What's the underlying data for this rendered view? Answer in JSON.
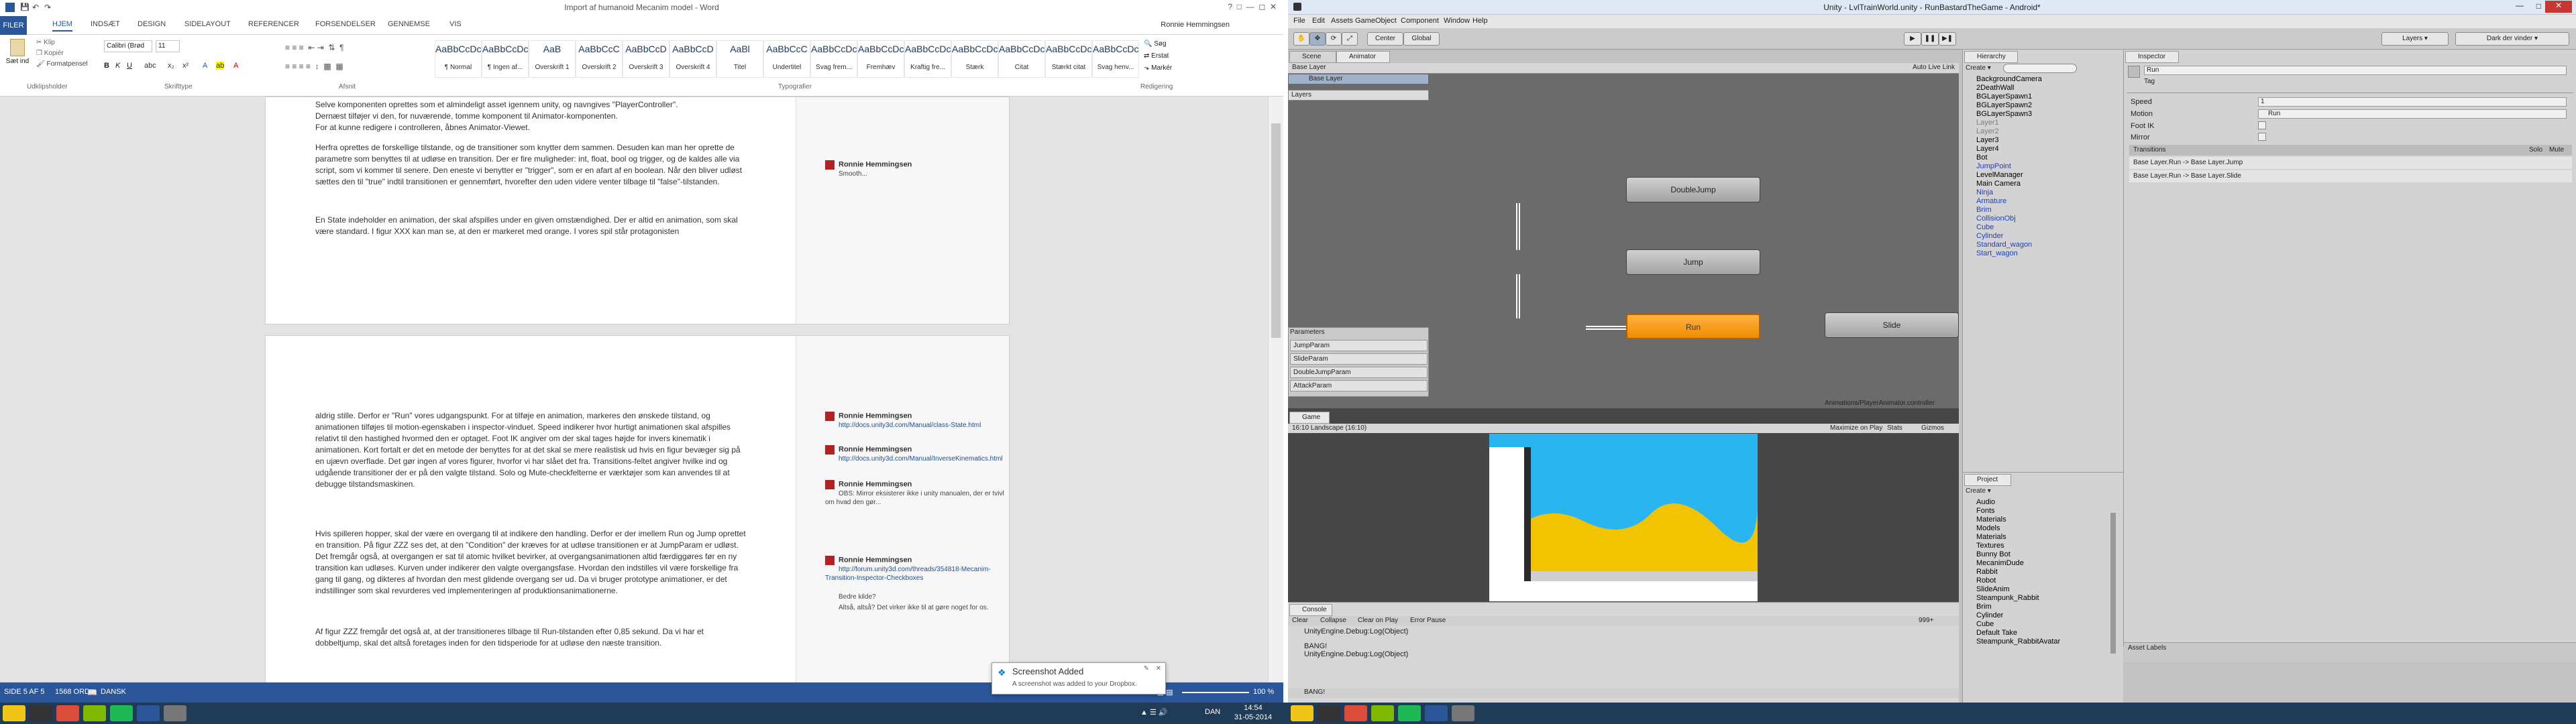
{
  "word": {
    "title": "Import af humanoid Mecanim model - Word",
    "user": "Ronnie Hemmingsen",
    "file_tab": "FILER",
    "tabs": [
      "HJEM",
      "INDSÆT",
      "DESIGN",
      "SIDELAYOUT",
      "REFERENCER",
      "FORSENDELSER",
      "GENNEMSE",
      "VIS"
    ],
    "clipboard": {
      "paste": "Sæt ind",
      "cut": "Klip",
      "copy": "Kopiér",
      "format_painter": "Formatpensel",
      "group": "Udklipsholder"
    },
    "font": {
      "name": "Calibri (Brød",
      "size": "11",
      "group": "Skrifttype"
    },
    "paragraph_group": "Afsnit",
    "styles": [
      {
        "preview": "AaBbCcDc",
        "name": "¶ Normal"
      },
      {
        "preview": "AaBbCcDc",
        "name": "¶ Ingen af..."
      },
      {
        "preview": "AaB",
        "name": "Overskrift 1"
      },
      {
        "preview": "AaBbCcC",
        "name": "Overskrift 2"
      },
      {
        "preview": "AaBbCcD",
        "name": "Overskrift 3"
      },
      {
        "preview": "AaBbCcD",
        "name": "Overskrift 4"
      },
      {
        "preview": "AaBl",
        "name": "Titel"
      },
      {
        "preview": "AaBbCcC",
        "name": "Undertitel"
      },
      {
        "preview": "AaBbCcDc",
        "name": "Svag frem..."
      },
      {
        "preview": "AaBbCcDc",
        "name": "Fremhæv"
      },
      {
        "preview": "AaBbCcDc",
        "name": "Kraftig fre..."
      },
      {
        "preview": "AaBbCcDc",
        "name": "Stærk"
      },
      {
        "preview": "AaBbCcDc",
        "name": "Citat"
      },
      {
        "preview": "AaBbCcDc",
        "name": "Stærkt citat"
      },
      {
        "preview": "AaBbCcDc",
        "name": "Svag henv..."
      }
    ],
    "styles_group": "Typografier",
    "editing": {
      "find": "Søg",
      "replace": "Erstat",
      "select": "Markér",
      "group": "Redigering"
    },
    "page1_paragraphs": [
      "Selve komponenten oprettes som et almindeligt asset igennem unity, og navngives \"PlayerController\".",
      "Dernæst tilføjer vi den, for nuværende, tomme komponent til Animator-komponenten.",
      "For at kunne redigere i controlleren, åbnes Animator-Viewet.",
      "Herfra oprettes de forskellige tilstande, og de transitioner som knytter dem sammen. Desuden kan man her oprette de parametre som benyttes til at udløse en transition. Der er fire muligheder: int, float, bool og trigger, og de kaldes alle via script, som vi kommer til senere. Den eneste vi benytter er \"trigger\", som er en afart af en boolean. Når den bliver udløst sættes den til \"true\" indtil transitionen er gennemført, hvorefter den uden videre venter tilbage til \"false\"-tilstanden.",
      "En State indeholder en animation, der skal afspilles under en given omstændighed. Der er altid en animation, som skal være standard. I figur XXX kan man se, at den er markeret med orange. I vores spil står protagonisten"
    ],
    "page1_comment": {
      "author": "Ronnie Hemmingsen",
      "text": "Smooth..."
    },
    "page2_paragraphs": [
      "aldrig stille. Derfor er \"Run\" vores udgangspunkt. For at tilføje en animation, markeres den ønskede tilstand, og animationen tilføjes til motion-egenskaben i inspector-vinduet. Speed indikerer hvor hurtigt animationen skal afspilles relativt til den hastighed hvormed den er optaget. Foot IK angiver om der skal tages højde for invers kinematik i animationen. Kort fortalt er det en metode der benyttes for at det skal se mere realistisk ud hvis en figur bevæger sig på en ujævn overflade. Det gør ingen af vores figurer, hvorfor vi har slået det fra. Transitions-feltet angiver hvilke ind og udgående transitioner der er på den valgte tilstand. Solo og Mute-checkfelterne er værktøjer som kan anvendes til at debugge tilstandsmaskinen.",
      "Hvis spilleren hopper, skal der være en overgang til at indikere den handling. Derfor er der imellem Run og Jump oprettet en transition. På figur ZZZ ses det, at den \"Condition\" der kræves for at udløse transitionen er at JumpParam er udløst. Det fremgår også, at overgangen er sat til atomic hvilket bevirker, at overgangsanimationen altid færdiggøres før en ny transition kan udløses. Kurven under indikerer den valgte overgangsfase. Hvordan den indstilles vil være forskellige fra gang til gang, og dikteres af hvordan den mest glidende overgang ser ud. Da vi bruger prototype animationer, er det indstillinger som skal revurderes ved implementeringen af produktionsanimationerne.",
      "Af figur ZZZ fremgår det også at, at der transitioneres tilbage til Run-tilstanden efter 0,85 sekund. Da vi har et dobbeltjump, skal det altså foretages inden for den tidsperiode for at udløse den næste transition."
    ],
    "page2_comments": [
      {
        "author": "Ronnie Hemmingsen",
        "text": "http://docs.unity3d.com/Manual/class-State.html"
      },
      {
        "author": "Ronnie Hemmingsen",
        "text": "http://docs.unity3d.com/Manual/InverseKinematics.html"
      },
      {
        "author": "Ronnie Hemmingsen",
        "text": "OBS: Mirror eksisterer ikke i unity manualen, der er tvivl om hvad den gør..."
      },
      {
        "author": "Ronnie Hemmingsen",
        "text": "http://forum.unity3d.com/threads/354818-Mecanim-Transition-Inspector-Checkboxes"
      },
      {
        "author": "",
        "text": "Bedre kilde?"
      },
      {
        "author": "",
        "text": "Altså, altså? Det virker ikke til at gøre noget for os."
      }
    ],
    "status": {
      "page": "SIDE 5 AF 5",
      "words": "1568 ORD",
      "lang": "DANSK",
      "zoom": "100 %"
    }
  },
  "unity": {
    "title": "Unity - LvlTrainWorld.unity - RunBastardTheGame - Android*",
    "menu": [
      "File",
      "Edit",
      "Assets",
      "GameObject",
      "Component",
      "Window",
      "Help"
    ],
    "toolbar": {
      "center": "Center",
      "global": "Global",
      "layers": "Layers",
      "layout": "Dark der vinder"
    },
    "tabs": {
      "scene": "Scene",
      "animator": "Animator",
      "game": "Game",
      "console": "Console",
      "hierarchy": "Hierarchy",
      "inspector": "Inspector",
      "project": "Project"
    },
    "animator": {
      "base_layer": "Base Layer",
      "layers_label": "Layers",
      "auto_live_link": "Auto Live Link",
      "states": [
        "DoubleJump",
        "Jump",
        "Run",
        "Slide"
      ],
      "parameters_label": "Parameters",
      "parameters": [
        "JumpParam",
        "SlideParam",
        "DoubleJumpParam",
        "AttackParam"
      ],
      "path": "Animations/PlayerAnimator.controller"
    },
    "game": {
      "aspect": "16:10 Landscape (16:10)",
      "maximize": "Maximize on Play",
      "stats": "Stats",
      "gizmos": "Gizmos"
    },
    "console": {
      "buttons": [
        "Clear",
        "Collapse",
        "Clear on Play",
        "Error Pause"
      ],
      "lines": [
        "UnityEngine.Debug:Log(Object)",
        "BANG!",
        "UnityEngine.Debug:Log(Object)"
      ],
      "count": "999+",
      "status": "BANG!"
    },
    "hierarchy": {
      "create": "Create",
      "items": [
        {
          "label": "BackgroundCamera",
          "type": "normal"
        },
        {
          "label": "2DeathWall",
          "type": "normal"
        },
        {
          "label": "BGLayerSpawn1",
          "type": "normal"
        },
        {
          "label": "BGLayerSpawn2",
          "type": "normal"
        },
        {
          "label": "BGLayerSpawn3",
          "type": "normal"
        },
        {
          "label": "Layer1",
          "type": "grey"
        },
        {
          "label": "Layer2",
          "type": "grey"
        },
        {
          "label": "Layer3",
          "type": "normal"
        },
        {
          "label": "Layer4",
          "type": "normal"
        },
        {
          "label": "Bot",
          "type": "normal"
        },
        {
          "label": "JumpPoint",
          "type": "blue"
        },
        {
          "label": "LevelManager",
          "type": "normal"
        },
        {
          "label": "Main Camera",
          "type": "normal"
        },
        {
          "label": "Ninja",
          "type": "blue"
        },
        {
          "label": "Armature",
          "type": "blue"
        },
        {
          "label": "Brim",
          "type": "blue"
        },
        {
          "label": "CollisionObj",
          "type": "blue"
        },
        {
          "label": "Cube",
          "type": "blue"
        },
        {
          "label": "Cylinder",
          "type": "blue"
        },
        {
          "label": "Standard_wagon",
          "type": "blue"
        },
        {
          "label": "Start_wagon",
          "type": "blue"
        }
      ]
    },
    "project": {
      "create": "Create",
      "items": [
        "Audio",
        "Fonts",
        "Materials",
        "Models",
        "Materials",
        "Textures",
        "Bunny Bot",
        "MecanimDude",
        "Rabbit",
        "Robot",
        "SlideAnim",
        "Steampunk_Rabbit",
        "Brim",
        "Cylinder",
        "Cube",
        "Default Take",
        "Steampunk_RabbitAvatar"
      ],
      "asset_labels": "Asset Labels"
    },
    "inspector": {
      "name": "Run",
      "tag": "Tag",
      "speed_label": "Speed",
      "speed_value": "1",
      "motion_label": "Motion",
      "motion_value": "Run",
      "footik_label": "Foot IK",
      "mirror_label": "Mirror",
      "transitions_label": "Transitions",
      "solo_label": "Solo",
      "mute_label": "Mute",
      "transitions": [
        "Base Layer.Run -> Base Layer.Jump",
        "Base Layer.Run -> Base Layer.Slide"
      ]
    }
  },
  "toast": {
    "title": "Screenshot Added",
    "text": "A screenshot was added to your Dropbox."
  },
  "taskbar": {
    "time": "14:54",
    "date": "31-05-2014",
    "lang": "DAN"
  }
}
